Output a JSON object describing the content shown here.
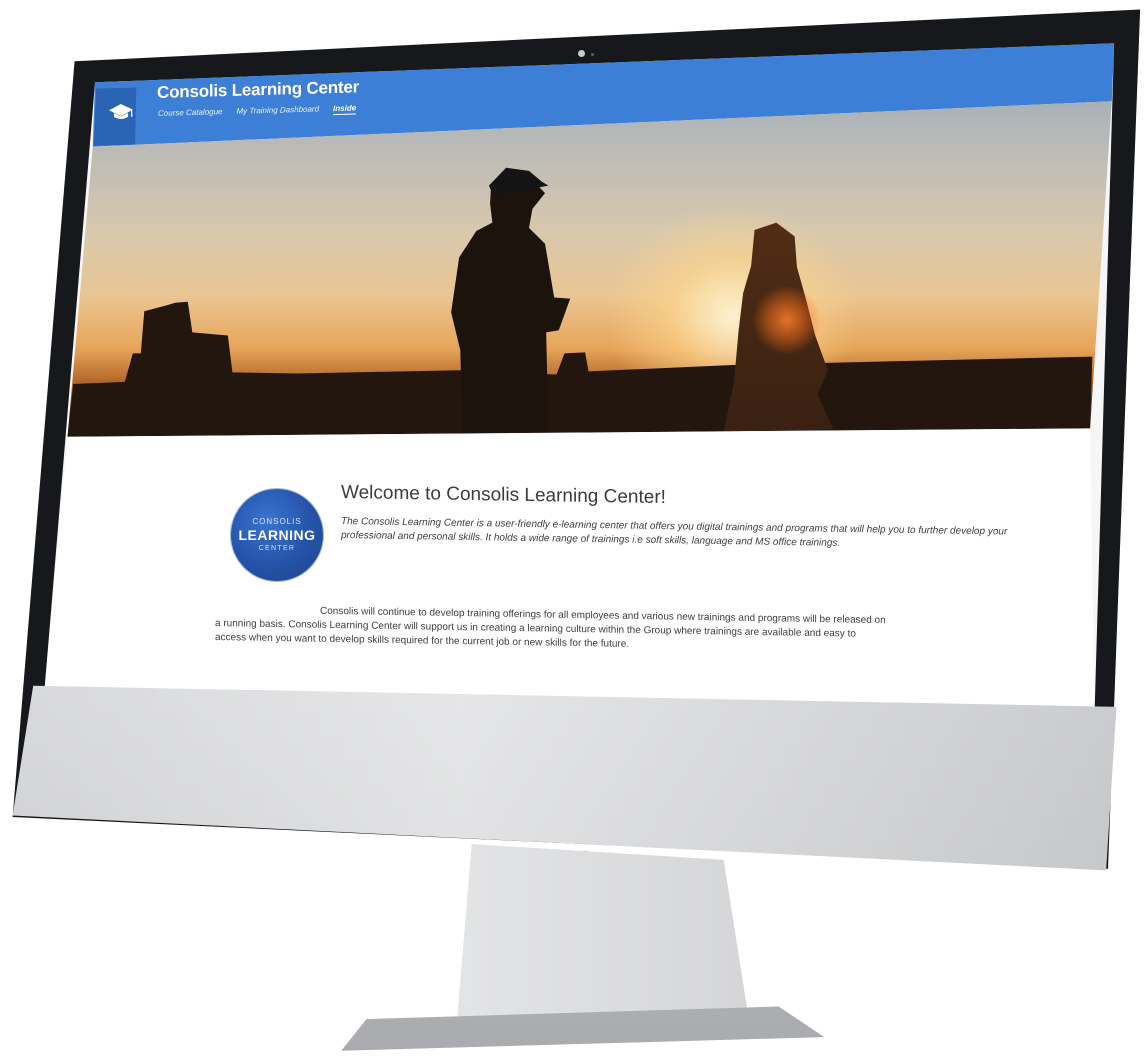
{
  "app": {
    "title": "Consolis Learning Center"
  },
  "nav": {
    "items": [
      {
        "label": "Course Catalogue",
        "active": false
      },
      {
        "label": "My Training Dashboard",
        "active": false
      },
      {
        "label": "Inside",
        "active": true
      }
    ]
  },
  "badge": {
    "top": "CONSOLIS",
    "main": "LEARNING",
    "bottom": "CENTER"
  },
  "welcome": {
    "title": "Welcome to Consolis Learning Center!",
    "intro": "The Consolis Learning Center is a user-friendly e-learning center that offers you digital trainings and programs that will help you to further develop your professional and personal skills. It holds a wide range of trainings i.e soft skills, language and MS office trainings.",
    "body_line1": "Consolis will continue to develop training offerings for all employees and various new trainings and programs will be released on",
    "body_line2": "a running basis. Consolis Learning Center will support us in creating a learning culture within the Group where trainings are available and easy to",
    "body_line3": "access when you want to develop skills required for the current job or new skills for the future."
  },
  "icons": {
    "logo": "graduation-cap-icon"
  },
  "colors": {
    "header": "#3d7ed6",
    "logo_box": "#2b63b5",
    "badge": "#2553a8"
  }
}
